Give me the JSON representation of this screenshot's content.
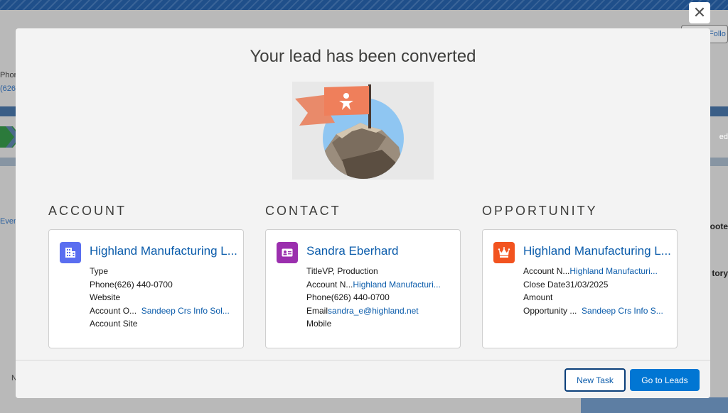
{
  "background": {
    "left_texts": [
      "Phor",
      "(626",
      "Even",
      "N"
    ],
    "right_texts": [
      "Follo",
      "ed",
      "oote",
      "tory"
    ]
  },
  "modal": {
    "title": "Your lead has been converted",
    "close_label": "✕",
    "sections": [
      {
        "heading": "ACCOUNT",
        "card_title": "Highland Manufacturing L...",
        "icon": "account-building-icon",
        "icon_color": "#5a6ef0",
        "fields": [
          {
            "label": "Type",
            "value": ""
          },
          {
            "label": "Phone",
            "value": "(626) 440-0700"
          },
          {
            "label": "Website",
            "value": ""
          },
          {
            "label": "Account O...",
            "value": "Sandeep Crs Info Sol..."
          },
          {
            "label": "Account Site",
            "value": ""
          }
        ]
      },
      {
        "heading": "CONTACT",
        "card_title": "Sandra Eberhard",
        "icon": "contact-card-icon",
        "icon_color": "#9b2fae",
        "fields": [
          {
            "label": "Title",
            "value": "VP, Production"
          },
          {
            "label": "Account N...",
            "value": "Highland Manufacturi..."
          },
          {
            "label": "Phone",
            "value": "(626) 440-0700"
          },
          {
            "label": "Email",
            "value": "sandra_e@highland.net"
          },
          {
            "label": "Mobile",
            "value": ""
          }
        ]
      },
      {
        "heading": "OPPORTUNITY",
        "card_title": "Highland Manufacturing L...",
        "icon": "opportunity-crown-icon",
        "icon_color": "#f2531f",
        "fields": [
          {
            "label": "Account N...",
            "value": "Highland Manufacturi..."
          },
          {
            "label": "Close Date",
            "value": "31/03/2025"
          },
          {
            "label": "Amount",
            "value": ""
          },
          {
            "label": "Opportunity ...",
            "value": "Sandeep Crs Info S..."
          }
        ]
      }
    ],
    "footer": {
      "new_task": "New Task",
      "go_to_leads": "Go to Leads"
    }
  }
}
